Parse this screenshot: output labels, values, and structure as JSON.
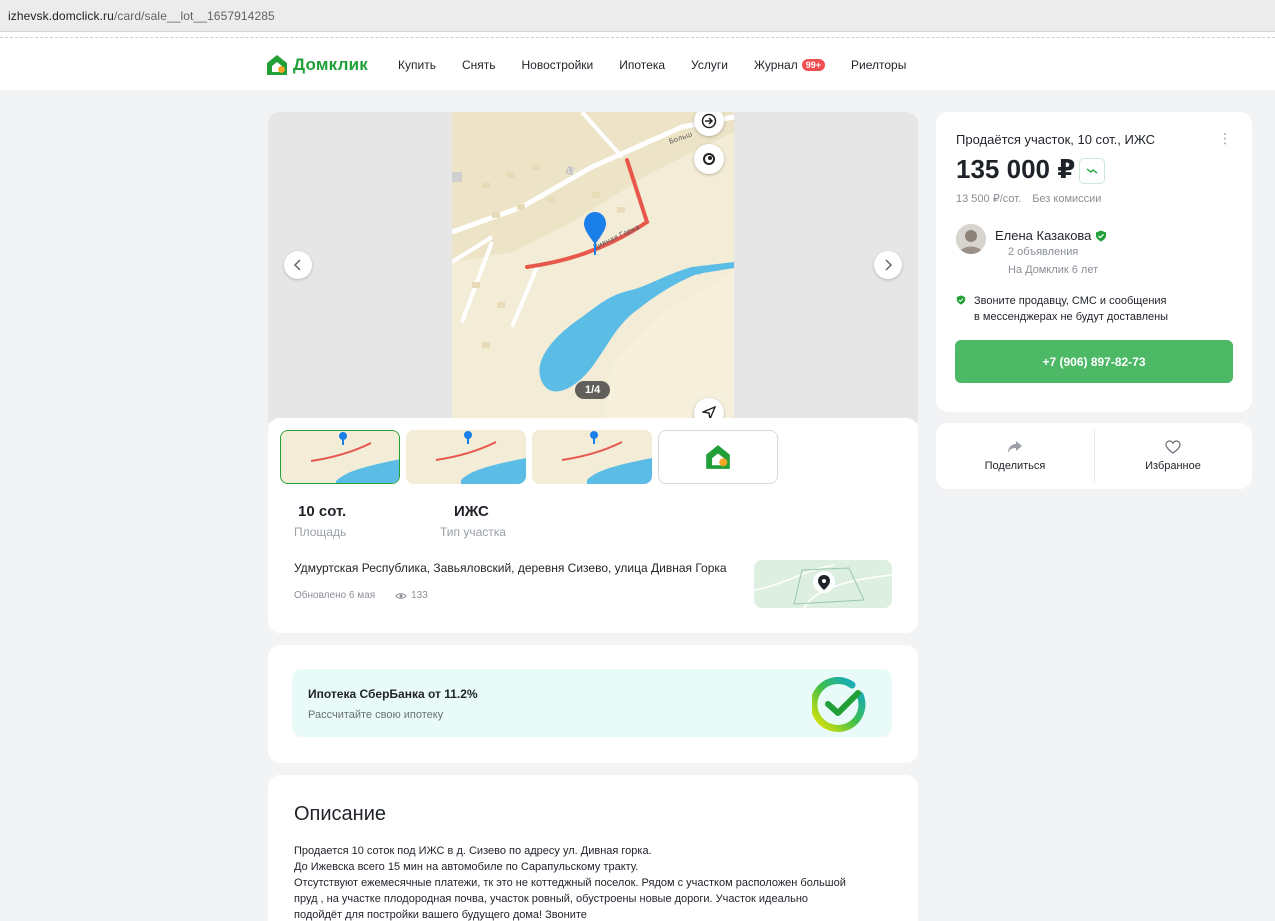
{
  "browser": {
    "url_host": "izhevsk.domclick.ru",
    "url_path": "/card/sale__lot__1657914285"
  },
  "header": {
    "logo_text": "Домклик",
    "nav": [
      {
        "label": "Купить"
      },
      {
        "label": "Снять"
      },
      {
        "label": "Новостройки"
      },
      {
        "label": "Ипотека"
      },
      {
        "label": "Услуги"
      },
      {
        "label": "Журнал",
        "badge": "99+"
      },
      {
        "label": "Риелторы"
      }
    ]
  },
  "gallery": {
    "counter": "1/4",
    "map_street_label_1": "Дивная Горка",
    "map_street_label_2": "Больш",
    "map_house_number": "13"
  },
  "features": [
    {
      "value": "10 сот.",
      "label": "Площадь"
    },
    {
      "value": "ИЖС",
      "label": "Тип участка"
    }
  ],
  "location": {
    "address": "Удмуртская Республика, Завьяловский, деревня Сизево, улица Дивная Горка",
    "updated": "Обновлено 6 мая",
    "views": "133"
  },
  "mortgage": {
    "title": "Ипотека СберБанка от 11.2%",
    "subtitle": "Рассчитайте свою ипотеку"
  },
  "description": {
    "title": "Описание",
    "lines": [
      "Продается 10 соток под ИЖС в д. Сизево по адресу ул. Дивная горка.",
      "До Ижевска всего 15 мин на автомобиле по Сарапульскому тракту.",
      "Отсутствуют ежемесячные платежи, тк это не коттеджный поселок. Рядом с участком расположен большой",
      "пруд , на участке плодородная почва, участок ровный, обустроены новые дороги. Участок идеально",
      "подойдёт для постройки вашего будущего дома! Звоните"
    ]
  },
  "offer": {
    "title": "Продаётся участок, 10 сот., ИЖС",
    "more": "⋮",
    "price": "135 000 ₽",
    "per_unit": "13 500 ₽/сот.",
    "commission": "Без комиссии",
    "seller": {
      "name": "Елена Казакова",
      "listings": "2 объявления",
      "since": "На Домклик 6 лет"
    },
    "notice_line1": "Звоните продавцу, СМС и сообщения",
    "notice_line2": "в мессенджерах не будут доставлены",
    "phone": "+7 (906) 897-82-73"
  },
  "actions": {
    "share": "Поделиться",
    "favorite": "Избранное"
  },
  "colors": {
    "brand_green": "#21a038",
    "button_green": "#4db866",
    "badge_red": "#ef4f4f",
    "route_red": "#e8574b",
    "water_blue": "#5bbde6",
    "pin_blue": "#1a7fe8"
  }
}
